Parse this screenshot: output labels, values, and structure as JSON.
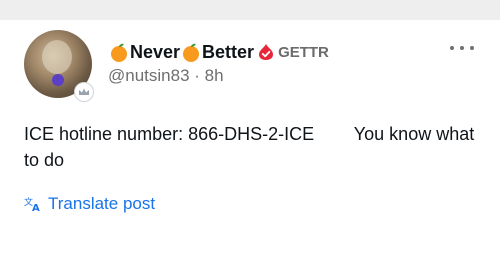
{
  "post": {
    "display_name_part1": "Never",
    "display_name_part2": "Better",
    "platform_label": "GETTR",
    "handle": "@nutsin83",
    "separator": " · ",
    "time_ago": "8h",
    "body_text": "ICE hotline number: 866-DHS-2-ICE        You know what to do",
    "translate_label": "Translate post"
  },
  "icons": {
    "name_emoji": "orange-emoji-icon",
    "verified": "gettr-verified-icon",
    "badge": "crown-badge-icon",
    "more": "more-options-icon",
    "translate": "translate-icon"
  },
  "colors": {
    "link": "#1a73e8",
    "verified_red": "#e8263a",
    "orange": "#f79a1e",
    "muted": "#6f6f6f"
  }
}
